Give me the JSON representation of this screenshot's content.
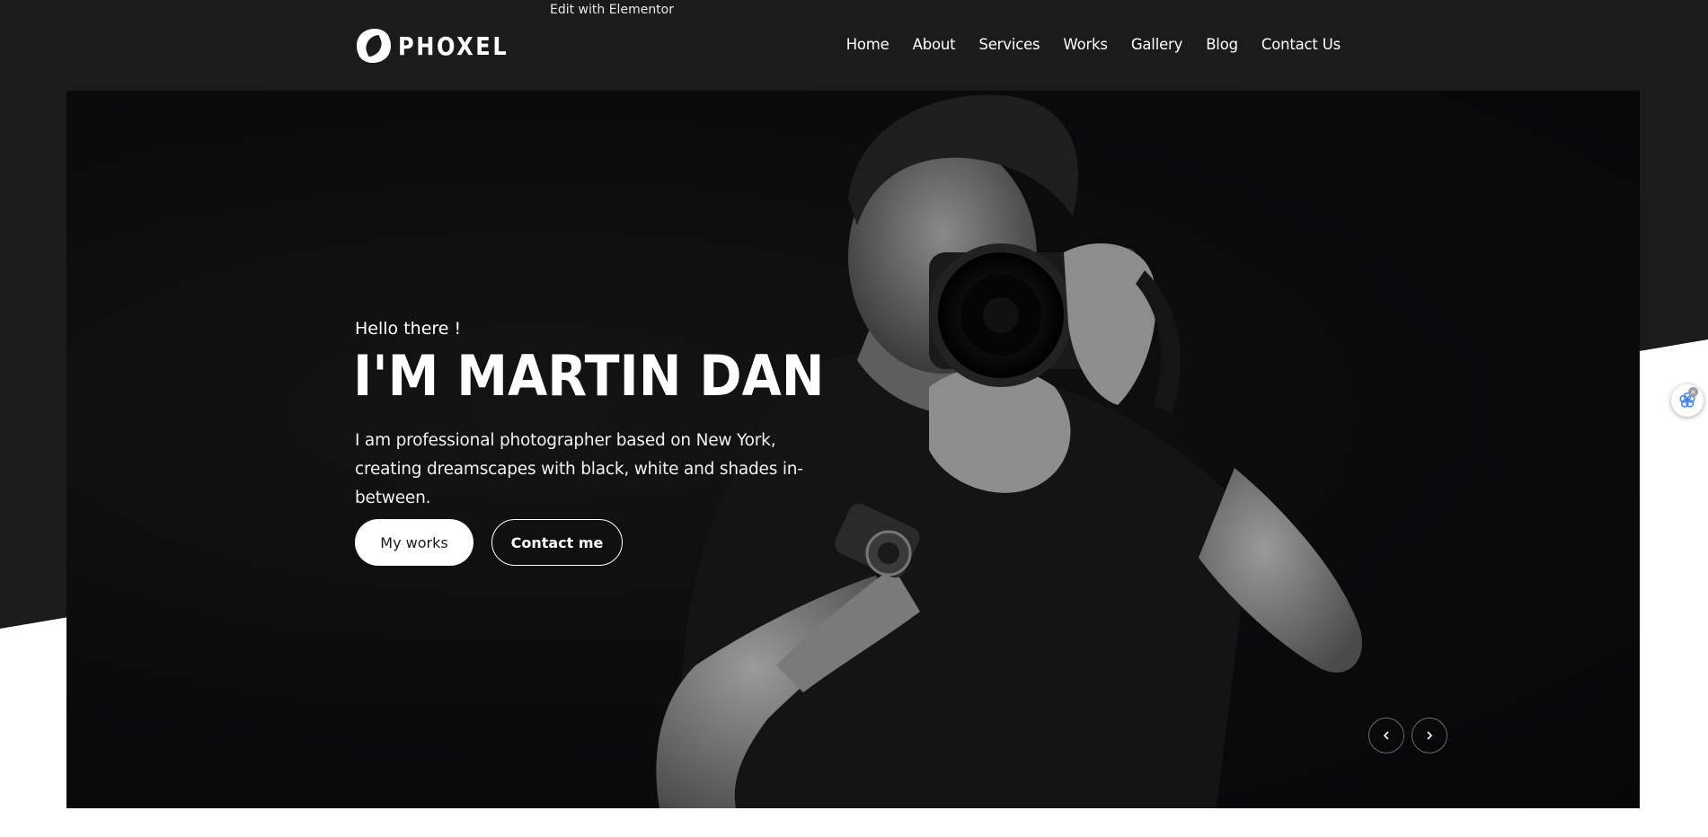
{
  "editor": {
    "edit_label": "Edit with Elementor"
  },
  "brand": {
    "name": "PHOXEL",
    "logo_icon": "phoxel-ring-logo"
  },
  "nav": {
    "items": [
      {
        "label": "Home"
      },
      {
        "label": "About"
      },
      {
        "label": "Services"
      },
      {
        "label": "Works"
      },
      {
        "label": "Gallery"
      },
      {
        "label": "Blog"
      },
      {
        "label": "Contact Us"
      }
    ]
  },
  "hero": {
    "greeting": "Hello there !",
    "name": "I'M MARTIN DAN",
    "description": "I am professional photographer based on New York, creating dreamscapes with black, white and shades in-between.",
    "primary_button": "My works",
    "secondary_button": "Contact me",
    "prev_icon": "chevron-left-icon",
    "next_icon": "chevron-right-icon"
  },
  "widget": {
    "icon": "assistant-flower-icon",
    "close_icon": "close-icon",
    "close_glyph": "×"
  },
  "colors": {
    "header_bg": "#1b1b1c",
    "hero_bg": "#0b0b0c",
    "text": "#ffffff",
    "widget_accent": "#3b82f6"
  }
}
